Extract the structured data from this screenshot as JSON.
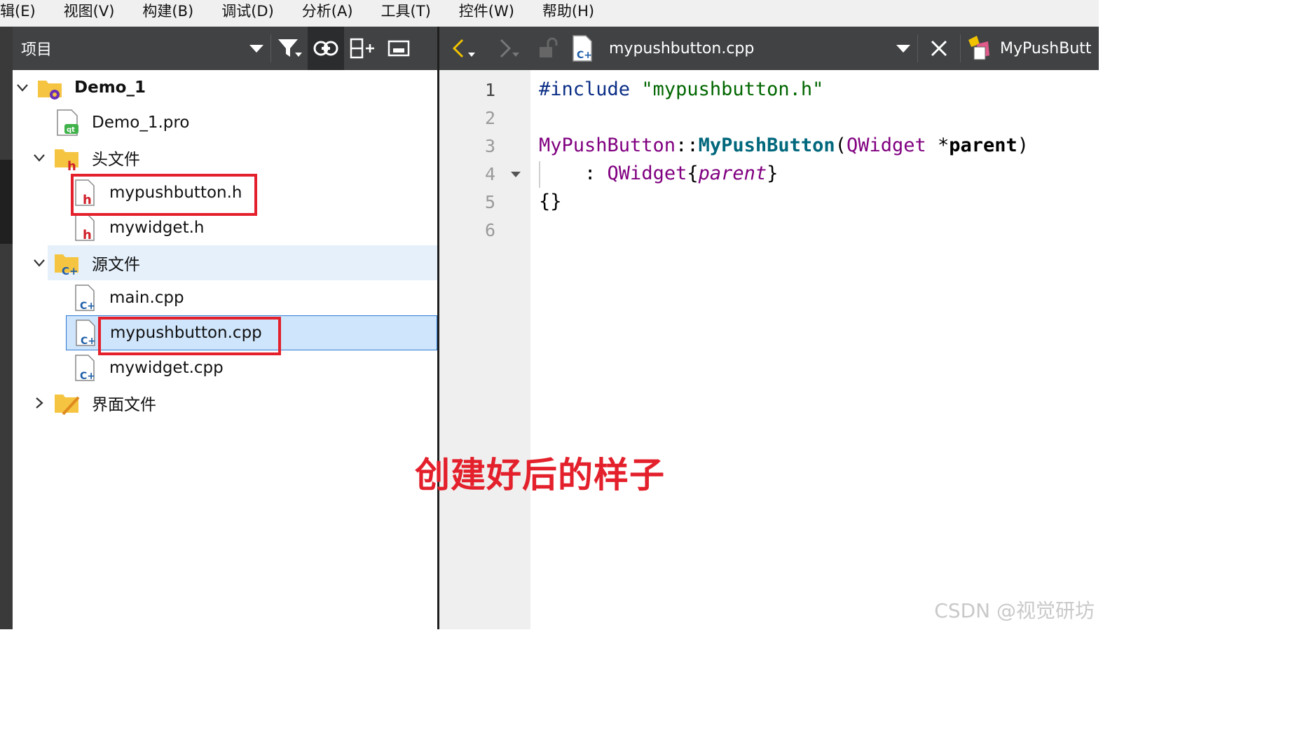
{
  "menu": [
    "辑(E)",
    "视图(V)",
    "构建(B)",
    "调试(D)",
    "分析(A)",
    "工具(T)",
    "控件(W)",
    "帮助(H)"
  ],
  "project_pane": {
    "title": "项目",
    "icons": [
      "dropdown-icon",
      "filter-icon",
      "link-icon",
      "split-add-icon",
      "close-pane-icon"
    ]
  },
  "tree": {
    "project": "Demo_1",
    "pro_file": "Demo_1.pro",
    "headers_folder": "头文件",
    "headers": [
      "mypushbutton.h",
      "mywidget.h"
    ],
    "sources_folder": "源文件",
    "sources": [
      "main.cpp",
      "mypushbutton.cpp",
      "mywidget.cpp"
    ],
    "forms_folder": "界面文件"
  },
  "editor": {
    "file_tab": "mypushbutton.cpp",
    "class_tab": "MyPushButt",
    "line_numbers": [
      "1",
      "2",
      "3",
      "4",
      "5",
      "6"
    ],
    "code": {
      "l1_directive": "#include",
      "l1_string": "\"mypushbutton.h\"",
      "l3_class": "MyPushButton",
      "l3_sep": "::",
      "l3_func": "MyPushButton",
      "l3_open": "(",
      "l3_type": "QWidget",
      "l3_star": " *",
      "l3_param": "parent",
      "l3_close": ")",
      "l4_colon": "    : ",
      "l4_base": "QWidget",
      "l4_lbrace": "{",
      "l4_arg": "parent",
      "l4_rbrace": "}",
      "l5": "{}"
    }
  },
  "annotation": "创建好后的样子",
  "watermark": "CSDN @视觉研坊",
  "colors": {
    "highlight_red": "#e3202b",
    "selection_bg": "#cfe5fb",
    "toolbar_bg": "#404244"
  }
}
